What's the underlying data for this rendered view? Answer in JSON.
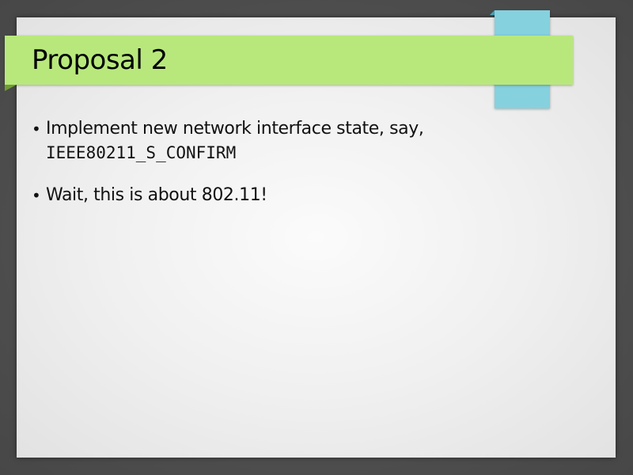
{
  "slide": {
    "title": "Proposal 2",
    "bullets": [
      {
        "text": "Implement new network interface state, say,",
        "code": "IEEE80211_S_CONFIRM"
      },
      {
        "text": "Wait, this is about 802.11!"
      }
    ]
  },
  "colors": {
    "title_bar": "#b8e87c",
    "tab": "#85d1de",
    "frame": "#4f4f4f"
  }
}
